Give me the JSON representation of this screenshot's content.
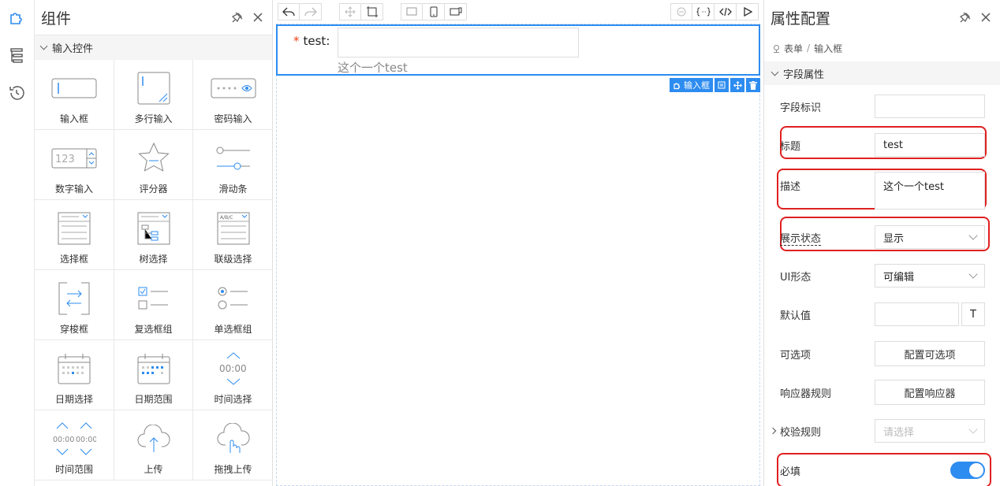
{
  "components_panel": {
    "title": "组件",
    "group_title": "输入控件",
    "items": [
      {
        "label": "输入框",
        "icon": "input-box-icon"
      },
      {
        "label": "多行输入",
        "icon": "textarea-icon"
      },
      {
        "label": "密码输入",
        "icon": "password-icon"
      },
      {
        "label": "数字输入",
        "icon": "number-input-icon"
      },
      {
        "label": "评分器",
        "icon": "star-rate-icon"
      },
      {
        "label": "滑动条",
        "icon": "slider-icon"
      },
      {
        "label": "选择框",
        "icon": "select-icon"
      },
      {
        "label": "树选择",
        "icon": "tree-select-icon"
      },
      {
        "label": "联级选择",
        "icon": "cascader-icon"
      },
      {
        "label": "穿梭框",
        "icon": "transfer-icon"
      },
      {
        "label": "复选框组",
        "icon": "checkbox-group-icon"
      },
      {
        "label": "单选框组",
        "icon": "radio-group-icon"
      },
      {
        "label": "日期选择",
        "icon": "date-picker-icon"
      },
      {
        "label": "日期范围",
        "icon": "date-range-icon"
      },
      {
        "label": "时间选择",
        "icon": "time-picker-icon"
      },
      {
        "label": "时间范围",
        "icon": "time-range-icon"
      },
      {
        "label": "上传",
        "icon": "upload-icon"
      },
      {
        "label": "拖拽上传",
        "icon": "drag-upload-icon"
      }
    ],
    "number_icon_text": "123",
    "time_icon_text": "00:00",
    "abc_text": "A/B/C"
  },
  "canvas": {
    "field": {
      "required_mark": "*",
      "label": "test",
      "colon": ":",
      "description": "这个一个test"
    },
    "field_tag": "输入框"
  },
  "properties": {
    "title": "属性配置",
    "breadcrumb": [
      "表单",
      "输入框"
    ],
    "breadcrumb_sep": "/",
    "section_title": "字段属性",
    "rows": {
      "field_id": {
        "label": "字段标识",
        "value": ""
      },
      "title": {
        "label": "标题",
        "value": "test"
      },
      "description": {
        "label": "描述",
        "value": "这个一个test"
      },
      "display_state": {
        "label": "展示状态",
        "value": "显示"
      },
      "ui_mode": {
        "label": "UI形态",
        "value": "可编辑"
      },
      "default_value": {
        "label": "默认值",
        "value": "",
        "btn": "T"
      },
      "options": {
        "label": "可选项",
        "btn": "配置可选项"
      },
      "responder": {
        "label": "响应器规则",
        "btn": "配置响应器"
      },
      "validation": {
        "label": "校验规则",
        "placeholder": "请选择"
      },
      "required": {
        "label": "必填",
        "on": true
      }
    }
  },
  "colors": {
    "accent": "#2d8cf0",
    "highlight": "#e02020"
  }
}
